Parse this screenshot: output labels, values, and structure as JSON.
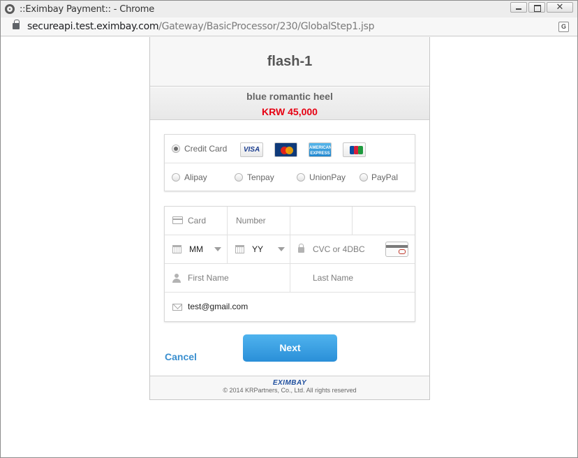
{
  "window": {
    "title": "::Eximbay Payment:: - Chrome",
    "close_glyph": "✕"
  },
  "address": {
    "host": "secureapi.test.eximbay.com",
    "path": "/Gateway/BasicProcessor/230/GlobalStep1.jsp",
    "translate_glyph": "G"
  },
  "merchant": {
    "name": "flash-1"
  },
  "order": {
    "product": "blue romantic heel",
    "price": "KRW 45,000",
    "price_color": "#e60012"
  },
  "payment_methods": {
    "credit_card": {
      "label": "Credit Card",
      "selected": true
    },
    "card_brands": [
      {
        "name": "VISA"
      },
      {
        "name": "MasterCard"
      },
      {
        "name": "AMERICAN EXPRESS"
      },
      {
        "name": "JCB"
      }
    ],
    "alipay": {
      "label": "Alipay",
      "selected": false
    },
    "tenpay": {
      "label": "Tenpay",
      "selected": false
    },
    "unionpay": {
      "label": "UnionPay",
      "selected": false
    },
    "paypal": {
      "label": "PayPal",
      "selected": false
    }
  },
  "card_form": {
    "card_label": "Card",
    "number_placeholder": "Number",
    "month_value": "MM",
    "year_value": "YY",
    "cvc_placeholder": "CVC or 4DBC",
    "first_name_placeholder": "First Name",
    "last_name_placeholder": "Last Name",
    "email_value": "test@gmail.com"
  },
  "actions": {
    "cancel_label": "Cancel",
    "next_label": "Next",
    "accent_color": "#2a8fd8"
  },
  "footer": {
    "brand": "EXIMBAY",
    "copyright": "© 2014 KRPartners, Co., Ltd. All rights reserved"
  }
}
